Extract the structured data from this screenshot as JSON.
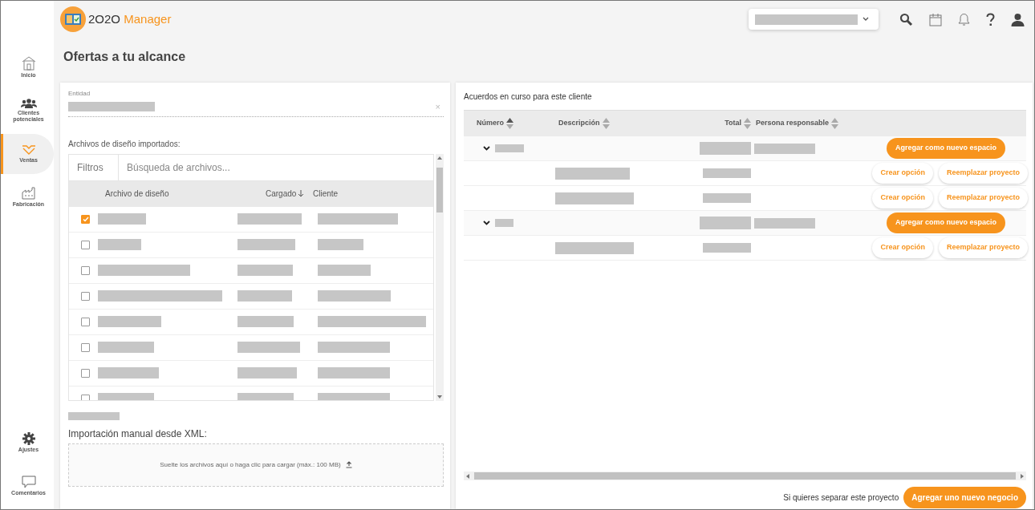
{
  "app": {
    "name_prefix": "2O2O",
    "name_suffix": "Manager"
  },
  "sidebar": {
    "items": [
      {
        "label": "Inicio",
        "selected": false
      },
      {
        "label": "Clientes potenciales",
        "selected": false
      },
      {
        "label": "Ventas",
        "selected": true
      },
      {
        "label": "Fabricación",
        "selected": false
      }
    ],
    "bottom_items": [
      {
        "label": "Ajustes"
      },
      {
        "label": "Comentarios"
      }
    ]
  },
  "page_title": "Ofertas a tu alcance",
  "left_panel": {
    "entity_label": "Entidad",
    "close_mark": "×",
    "files_label": "Archivos de diseño importados:",
    "filter_button": "Filtros",
    "search": {
      "placeholder": "Búsqueda de archivos..."
    },
    "columns": [
      {
        "label": "Archivo de diseño",
        "sorted": false
      },
      {
        "label": "Cargado",
        "sorted": true
      },
      {
        "label": "Cliente",
        "sorted": false
      }
    ],
    "rows": [
      {
        "checked": true
      },
      {
        "checked": false
      },
      {
        "checked": false
      },
      {
        "checked": false
      },
      {
        "checked": false
      },
      {
        "checked": false
      },
      {
        "checked": false
      },
      {
        "checked": false
      }
    ],
    "import_label": "Importación manual desde XML:",
    "dropzone_text": "Suelte los archivos aquí o haga clic para cargar (máx.: 100 MB)"
  },
  "right_panel": {
    "title": "Acuerdos en curso para este cliente",
    "columns": [
      {
        "label": "Número"
      },
      {
        "label": "Descripción"
      },
      {
        "label": "Total"
      },
      {
        "label": "Persona responsable"
      }
    ],
    "rows": [
      {
        "kind": "group",
        "expanded": true,
        "button": "Agregar como nuevo espacio"
      },
      {
        "kind": "item",
        "buttons": [
          "Crear opción",
          "Reemplazar proyecto"
        ]
      },
      {
        "kind": "item",
        "buttons": [
          "Crear opción",
          "Reemplazar proyecto"
        ]
      },
      {
        "kind": "group",
        "expanded": true,
        "button": "Agregar como nuevo espacio"
      },
      {
        "kind": "item",
        "buttons": [
          "Crear opción",
          "Reemplazar proyecto"
        ]
      }
    ],
    "footer_text": "Si quieres separar este proyecto",
    "footer_button": "Agregar uno nuevo negocio"
  }
}
